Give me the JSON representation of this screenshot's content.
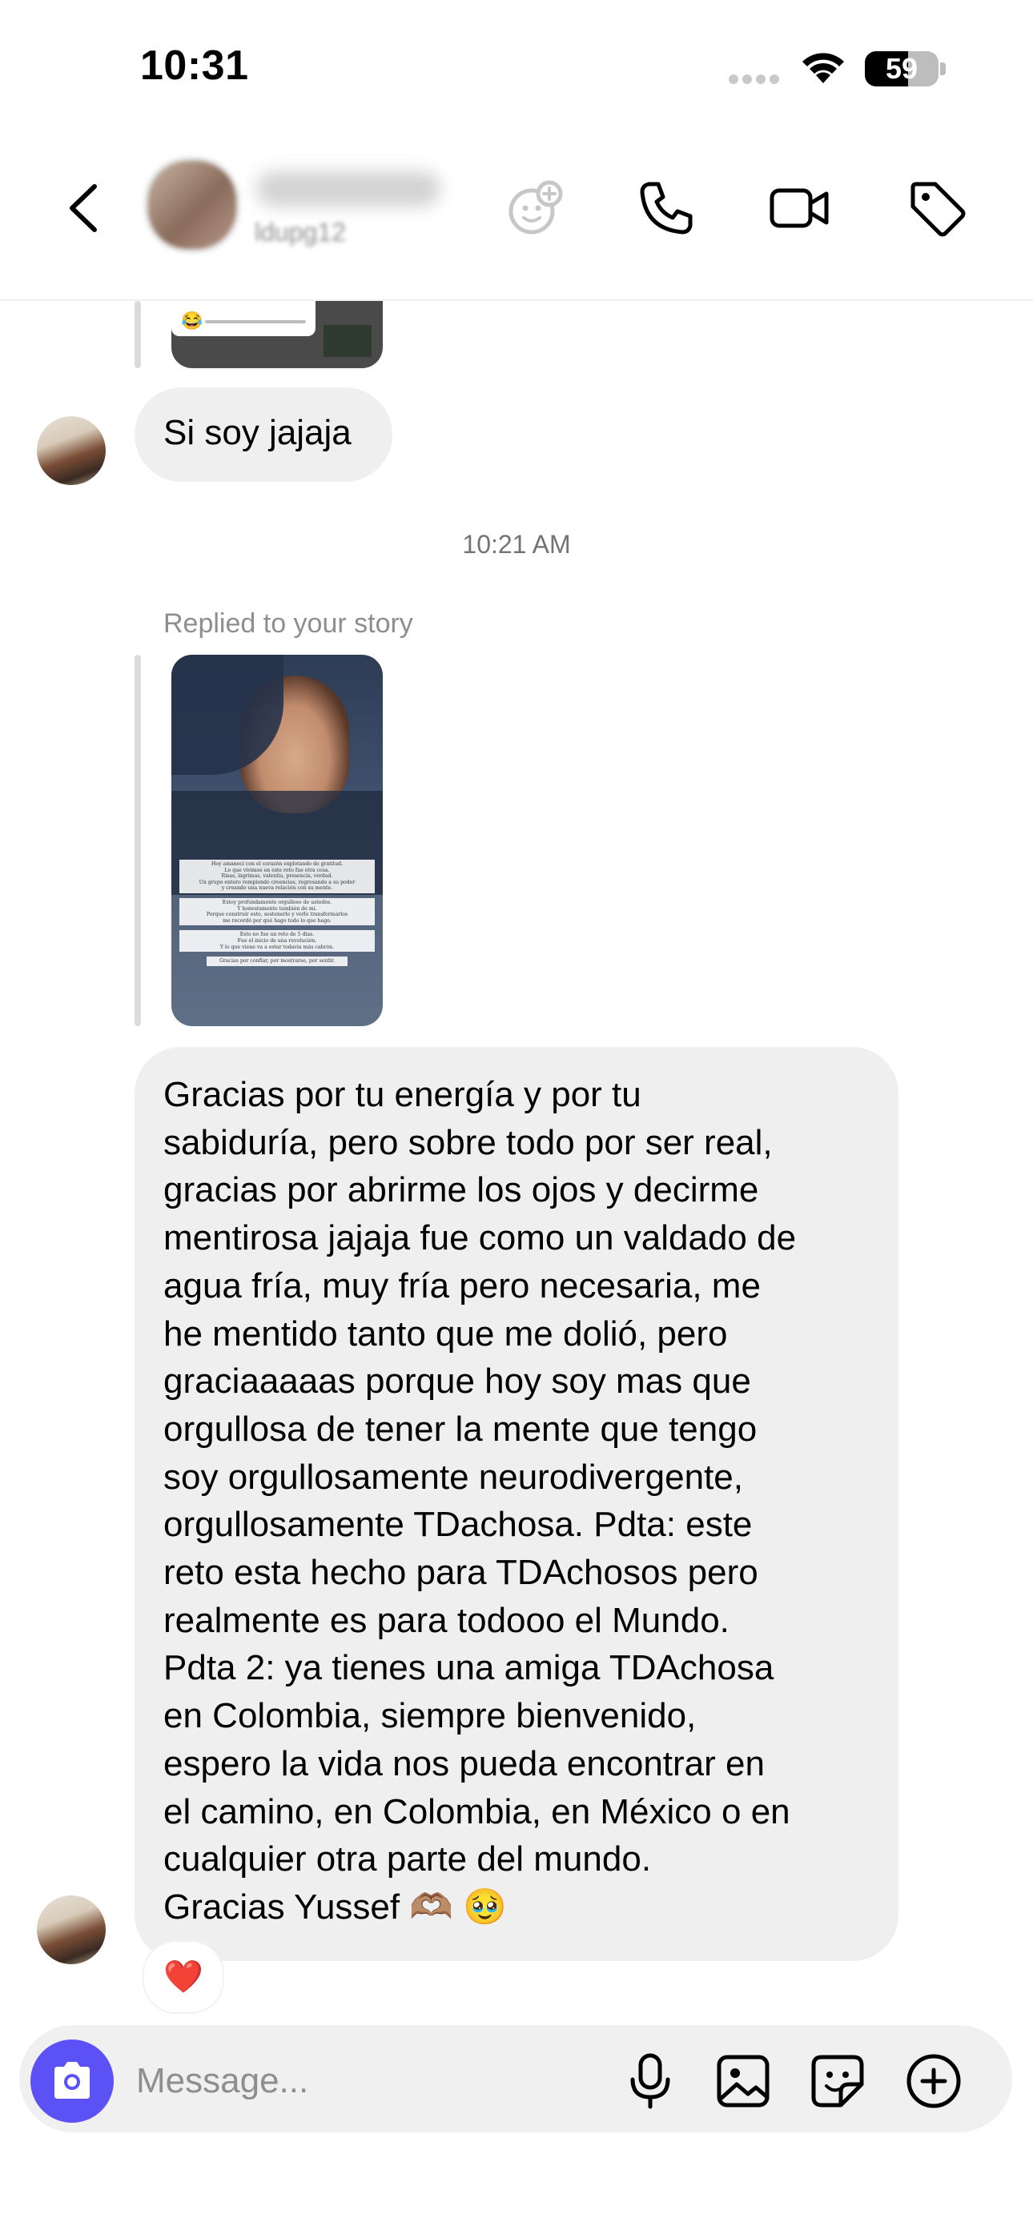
{
  "status_bar": {
    "time": "10:31",
    "battery_level": "59",
    "battery_fraction": 0.59
  },
  "header": {
    "username": "ldupg12",
    "icons": [
      "back-arrow-icon",
      "effects-icon",
      "phone-icon",
      "video-camera-icon",
      "tag-icon"
    ]
  },
  "chat": {
    "earlier_story_preview": {
      "icon": "laughing-emoji-slider"
    },
    "message_short": "Si soy jajaja",
    "timestamp": "10:21 AM",
    "reply_label": "Replied to your story",
    "story_caption_lines": [
      "Hoy amanecí con el corazón explotando de gratitud.",
      "Lo que vivimos en este reto fue otra cosa.",
      "Risas, lágrimas, valentía, presencia, verdad.",
      "Un grupo entero rompiendo creencias, regresando a su poder",
      "y creando una nueva relación con su mente.",
      "Estoy profundamente orgulloso de ustedes.",
      "Y honestamente también de mí.",
      "Porque construir esto, sostenerlo y verlo transformarlos",
      "me recordó por qué hago todo lo que hago.",
      "Esto no fue un reto de 5 días.",
      "Fue el inicio de una revolución.",
      "Y lo que viene va a estar todavía más cabrón.",
      "Gracias por confiar, por mostrarse, por sentir."
    ],
    "message_long_lines": [
      "Gracias por tu energía y por tu",
      "sabiduría, pero sobre todo por ser real,",
      "gracias por abrirme los ojos y decirme",
      "mentirosa jajaja fue como un valdado de",
      "agua fría, muy fría pero necesaria, me",
      "he mentido tanto que me dolió, pero",
      "graciaaaaas porque hoy soy mas que",
      "orgullosa de tener la mente que tengo",
      "soy orgullosamente neurodivergente,",
      "orgullosamente TDachosa. Pdta: este",
      "reto esta hecho para TDAchosos pero",
      "realmente es para todooo el Mundo.",
      "Pdta 2: ya tienes una amiga TDAchosa",
      "en Colombia, siempre bienvenido,",
      "espero la vida nos pueda encontrar en",
      "el camino, en Colombia, en México o en",
      "cualquier otra parte del mundo.",
      "Gracias Yussef 🫶🏽 🥹"
    ],
    "reaction": "❤️"
  },
  "composer": {
    "placeholder": "Message...",
    "icons": [
      "camera-icon",
      "microphone-icon",
      "gallery-icon",
      "sticker-icon",
      "plus-circle-icon"
    ]
  },
  "colors": {
    "accent": "#5b51f5",
    "bubble": "#efefef",
    "secondary_text": "#8e8e8e"
  }
}
